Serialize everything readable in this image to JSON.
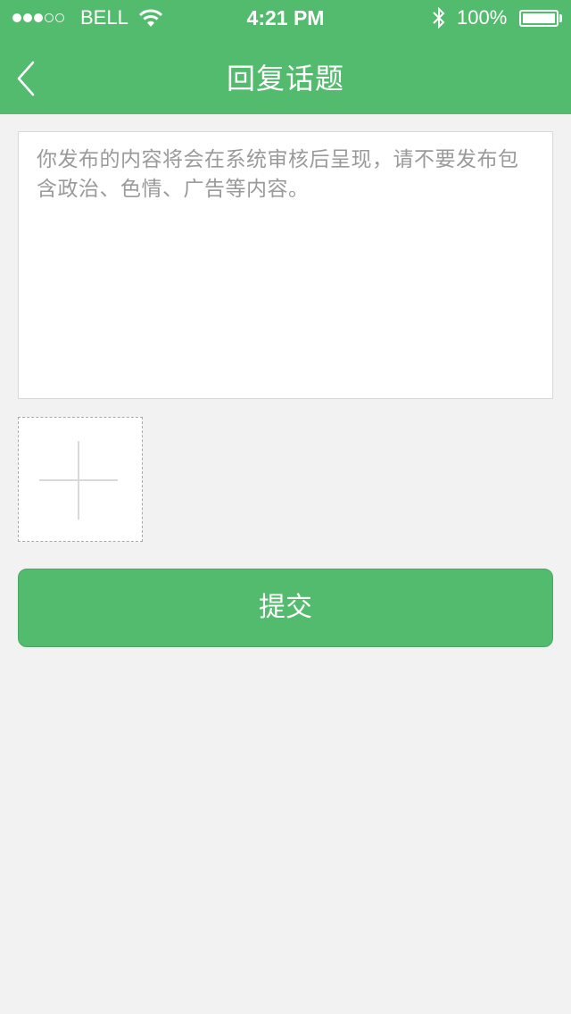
{
  "status_bar": {
    "carrier": "BELL",
    "time": "4:21 PM",
    "battery": "100%"
  },
  "nav": {
    "title": "回复话题",
    "back_icon": "chevron-left-icon"
  },
  "compose": {
    "placeholder": "你发布的内容将会在系统审核后呈现，请不要发布包含政治、色情、广告等内容。"
  },
  "image_picker": {
    "icon": "plus-icon"
  },
  "submit": {
    "label": "提交"
  },
  "colors": {
    "accent": "#53bb6e",
    "background": "#f2f2f2",
    "placeholder_text": "#9a9a9a"
  }
}
